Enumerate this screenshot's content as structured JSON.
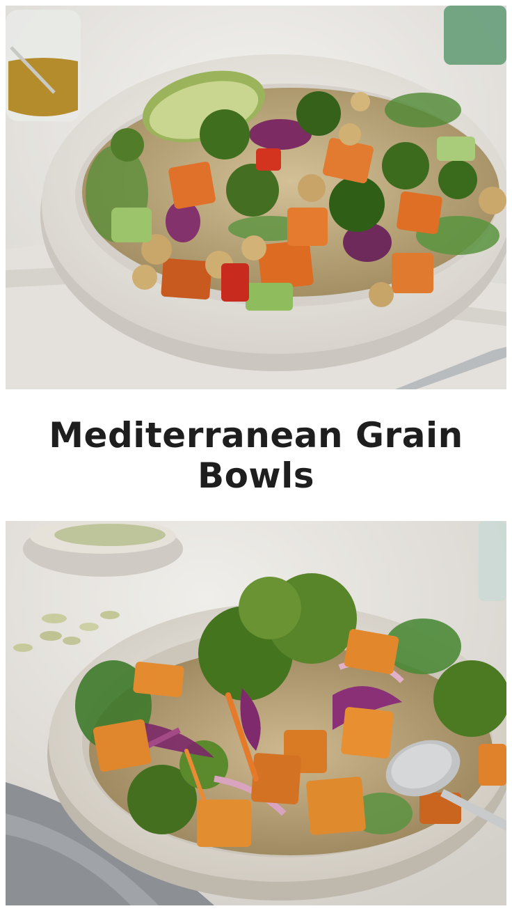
{
  "title": "Mediterranean Grain Bowls",
  "colors": {
    "background": "#ffffff",
    "title_text": "#1e1e1e",
    "bowl_rim": "#ebe8e2",
    "quinoa": "#c9b48a",
    "sweet_potato": "#e2742a",
    "broccoli": "#4e7d2a",
    "red_cabbage": "#8a2f6e",
    "avocado": "#b9c98a"
  }
}
